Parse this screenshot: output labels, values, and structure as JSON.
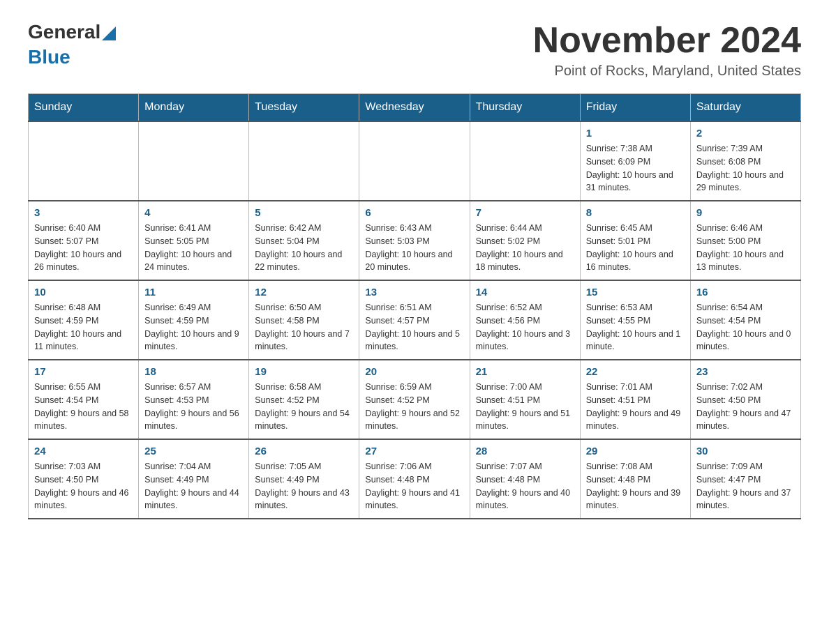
{
  "logo": {
    "general": "General",
    "blue": "Blue"
  },
  "header": {
    "month_year": "November 2024",
    "location": "Point of Rocks, Maryland, United States"
  },
  "days_of_week": [
    "Sunday",
    "Monday",
    "Tuesday",
    "Wednesday",
    "Thursday",
    "Friday",
    "Saturday"
  ],
  "weeks": [
    [
      {
        "day": "",
        "info": ""
      },
      {
        "day": "",
        "info": ""
      },
      {
        "day": "",
        "info": ""
      },
      {
        "day": "",
        "info": ""
      },
      {
        "day": "",
        "info": ""
      },
      {
        "day": "1",
        "info": "Sunrise: 7:38 AM\nSunset: 6:09 PM\nDaylight: 10 hours and 31 minutes."
      },
      {
        "day": "2",
        "info": "Sunrise: 7:39 AM\nSunset: 6:08 PM\nDaylight: 10 hours and 29 minutes."
      }
    ],
    [
      {
        "day": "3",
        "info": "Sunrise: 6:40 AM\nSunset: 5:07 PM\nDaylight: 10 hours and 26 minutes."
      },
      {
        "day": "4",
        "info": "Sunrise: 6:41 AM\nSunset: 5:05 PM\nDaylight: 10 hours and 24 minutes."
      },
      {
        "day": "5",
        "info": "Sunrise: 6:42 AM\nSunset: 5:04 PM\nDaylight: 10 hours and 22 minutes."
      },
      {
        "day": "6",
        "info": "Sunrise: 6:43 AM\nSunset: 5:03 PM\nDaylight: 10 hours and 20 minutes."
      },
      {
        "day": "7",
        "info": "Sunrise: 6:44 AM\nSunset: 5:02 PM\nDaylight: 10 hours and 18 minutes."
      },
      {
        "day": "8",
        "info": "Sunrise: 6:45 AM\nSunset: 5:01 PM\nDaylight: 10 hours and 16 minutes."
      },
      {
        "day": "9",
        "info": "Sunrise: 6:46 AM\nSunset: 5:00 PM\nDaylight: 10 hours and 13 minutes."
      }
    ],
    [
      {
        "day": "10",
        "info": "Sunrise: 6:48 AM\nSunset: 4:59 PM\nDaylight: 10 hours and 11 minutes."
      },
      {
        "day": "11",
        "info": "Sunrise: 6:49 AM\nSunset: 4:59 PM\nDaylight: 10 hours and 9 minutes."
      },
      {
        "day": "12",
        "info": "Sunrise: 6:50 AM\nSunset: 4:58 PM\nDaylight: 10 hours and 7 minutes."
      },
      {
        "day": "13",
        "info": "Sunrise: 6:51 AM\nSunset: 4:57 PM\nDaylight: 10 hours and 5 minutes."
      },
      {
        "day": "14",
        "info": "Sunrise: 6:52 AM\nSunset: 4:56 PM\nDaylight: 10 hours and 3 minutes."
      },
      {
        "day": "15",
        "info": "Sunrise: 6:53 AM\nSunset: 4:55 PM\nDaylight: 10 hours and 1 minute."
      },
      {
        "day": "16",
        "info": "Sunrise: 6:54 AM\nSunset: 4:54 PM\nDaylight: 10 hours and 0 minutes."
      }
    ],
    [
      {
        "day": "17",
        "info": "Sunrise: 6:55 AM\nSunset: 4:54 PM\nDaylight: 9 hours and 58 minutes."
      },
      {
        "day": "18",
        "info": "Sunrise: 6:57 AM\nSunset: 4:53 PM\nDaylight: 9 hours and 56 minutes."
      },
      {
        "day": "19",
        "info": "Sunrise: 6:58 AM\nSunset: 4:52 PM\nDaylight: 9 hours and 54 minutes."
      },
      {
        "day": "20",
        "info": "Sunrise: 6:59 AM\nSunset: 4:52 PM\nDaylight: 9 hours and 52 minutes."
      },
      {
        "day": "21",
        "info": "Sunrise: 7:00 AM\nSunset: 4:51 PM\nDaylight: 9 hours and 51 minutes."
      },
      {
        "day": "22",
        "info": "Sunrise: 7:01 AM\nSunset: 4:51 PM\nDaylight: 9 hours and 49 minutes."
      },
      {
        "day": "23",
        "info": "Sunrise: 7:02 AM\nSunset: 4:50 PM\nDaylight: 9 hours and 47 minutes."
      }
    ],
    [
      {
        "day": "24",
        "info": "Sunrise: 7:03 AM\nSunset: 4:50 PM\nDaylight: 9 hours and 46 minutes."
      },
      {
        "day": "25",
        "info": "Sunrise: 7:04 AM\nSunset: 4:49 PM\nDaylight: 9 hours and 44 minutes."
      },
      {
        "day": "26",
        "info": "Sunrise: 7:05 AM\nSunset: 4:49 PM\nDaylight: 9 hours and 43 minutes."
      },
      {
        "day": "27",
        "info": "Sunrise: 7:06 AM\nSunset: 4:48 PM\nDaylight: 9 hours and 41 minutes."
      },
      {
        "day": "28",
        "info": "Sunrise: 7:07 AM\nSunset: 4:48 PM\nDaylight: 9 hours and 40 minutes."
      },
      {
        "day": "29",
        "info": "Sunrise: 7:08 AM\nSunset: 4:48 PM\nDaylight: 9 hours and 39 minutes."
      },
      {
        "day": "30",
        "info": "Sunrise: 7:09 AM\nSunset: 4:47 PM\nDaylight: 9 hours and 37 minutes."
      }
    ]
  ]
}
